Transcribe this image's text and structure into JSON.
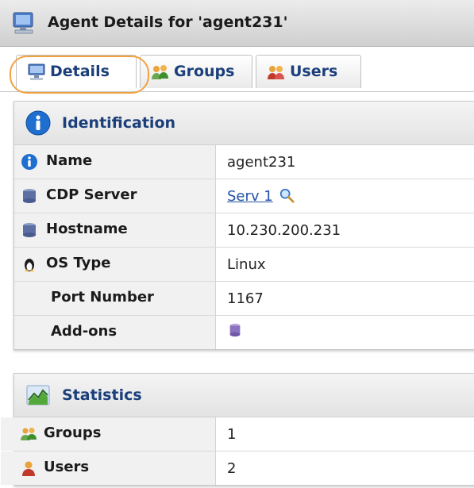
{
  "window": {
    "title": "Agent Details for 'agent231'",
    "icon": "computer-icon"
  },
  "tabs": [
    {
      "label": "Details",
      "icon": "computer-icon",
      "active": true
    },
    {
      "label": "Groups",
      "icon": "groups-icon",
      "active": false
    },
    {
      "label": "Users",
      "icon": "users-icon",
      "active": false
    }
  ],
  "identification": {
    "title": "Identification",
    "icon": "info-icon",
    "rows": [
      {
        "label": "Name",
        "value": "agent231",
        "icon": "info-icon"
      },
      {
        "label": "CDP Server",
        "value": "Serv 1",
        "icon": "database-icon",
        "value_icon": "magnifier-icon"
      },
      {
        "label": "Hostname",
        "value": "10.230.200.231",
        "icon": "database-icon"
      },
      {
        "label": "OS Type",
        "value": "Linux",
        "icon": "linux-penguin-icon"
      },
      {
        "label": "Port Number",
        "value": "1167"
      },
      {
        "label": "Add-ons",
        "value_icon": "addon-cylinder-icon"
      }
    ]
  },
  "statistics": {
    "title": "Statistics",
    "icon": "chart-icon",
    "rows": [
      {
        "label": "Groups",
        "value": "1",
        "icon": "groups-icon"
      },
      {
        "label": "Users",
        "value": "2",
        "icon": "user-icon"
      }
    ]
  },
  "colors": {
    "accent": "#1b3f7a",
    "highlight": "#f2a141",
    "link": "#2551a8"
  }
}
